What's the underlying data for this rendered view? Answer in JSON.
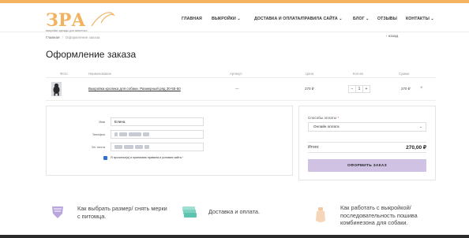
{
  "colors": {
    "accent": "#f2b25f",
    "button_bg": "#cfc2e3",
    "checkbox": "#2f6fd6"
  },
  "header": {
    "logo_text": "ЗРА",
    "logo_tagline": "выкройки одежды для животных",
    "nav": [
      {
        "label": "ГЛАВНАЯ"
      },
      {
        "label": "ВЫКРОЙКИ ⌄"
      },
      {
        "label": "ДОСТАВКА И ОПЛАТА/ПРАВИЛА САЙТА ⌄"
      },
      {
        "label": "БЛОГ ⌄"
      },
      {
        "label": "ОТЗЫВЫ"
      },
      {
        "label": "КОНТАКТЫ ⌄"
      }
    ]
  },
  "breadcrumb": {
    "home": "Главная",
    "separator": "/",
    "current": "Оформление заказа"
  },
  "back_link": "‹ назад",
  "page_title": "Оформление заказа",
  "cart": {
    "columns": [
      "Фото",
      "Наименование",
      "Артикул",
      "Цена",
      "Кол-во",
      "Сумма"
    ],
    "items": [
      {
        "name": "Выкройка кролика для собаки. Размерный ряд 30-55-50",
        "sku": "—",
        "price": "270 ₽",
        "qty": "1",
        "qty_minus": "−",
        "qty_plus": "+",
        "sum": "270 ₽",
        "remove": "×"
      }
    ]
  },
  "form": {
    "name_label": "Имя",
    "name_value": "Елена",
    "phone_label": "Телефон",
    "email_label": "Эл. почта",
    "terms": "Я прочитал(а) и принимаю правила и условия сайта",
    "terms_required": "*"
  },
  "order": {
    "payment_label": "Способы оплаты",
    "payment_required": "*",
    "payment_selected": "Онлайн оплата",
    "total_label": "Итого:",
    "total_value": "270,00 ₽",
    "submit_label": "ОФОРМИТЬ ЗАКАЗ"
  },
  "features": [
    {
      "line1": "Как выбрать размер/ снять мерки",
      "line2": "с питомца.",
      "line3": "",
      "icon": "box-icon"
    },
    {
      "line1": "Доставка и оплата.",
      "line2": "",
      "line3": "",
      "icon": "cards-icon"
    },
    {
      "line1": "Как работать с выкройкой/",
      "line2": "последовательность пошива",
      "line3": "комбинезона для собаки.",
      "icon": "bottle-icon"
    }
  ]
}
